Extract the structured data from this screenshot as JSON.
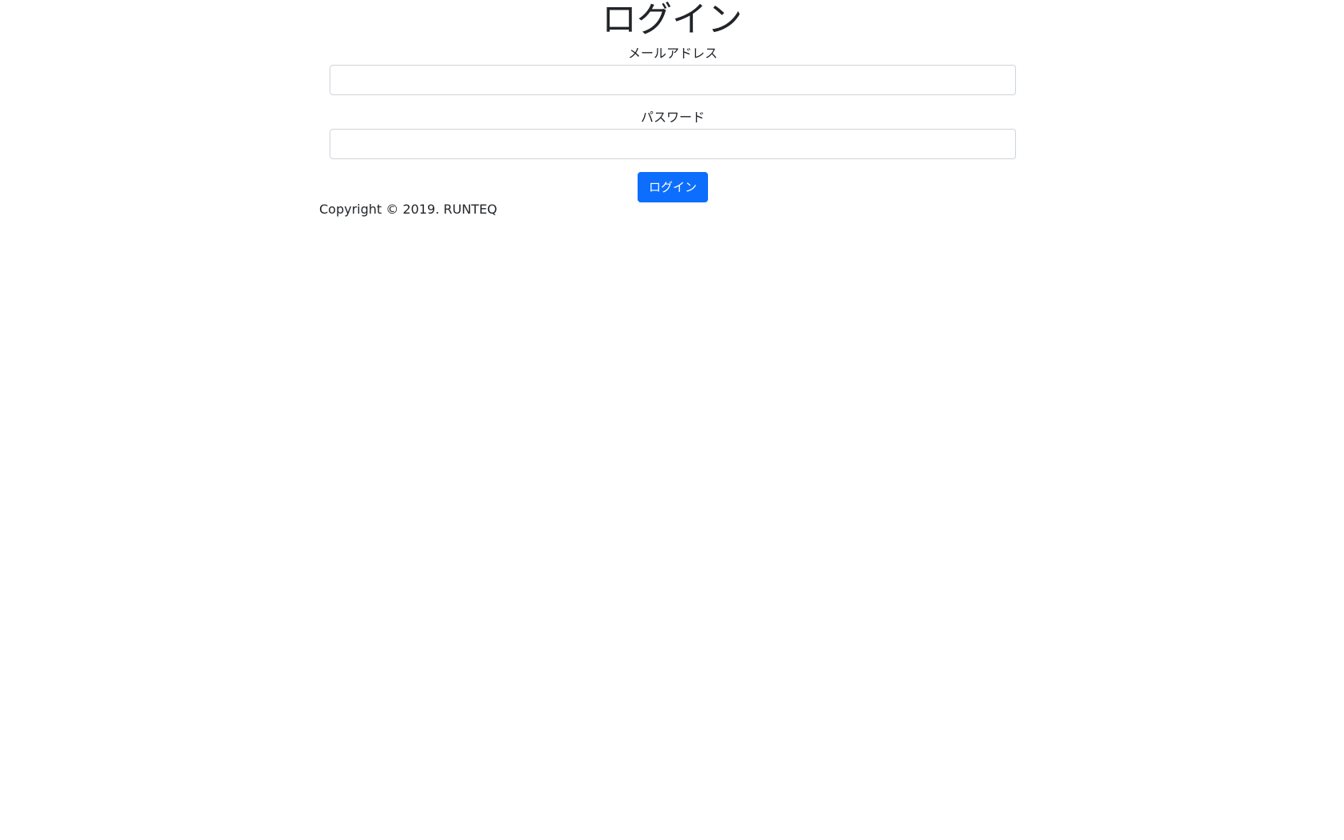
{
  "page": {
    "title": "ログイン"
  },
  "form": {
    "email_label": "メールアドレス",
    "email_value": "",
    "password_label": "パスワード",
    "password_value": "",
    "submit_label": "ログイン"
  },
  "footer": {
    "copyright": "Copyright © 2019. RUNTEQ"
  },
  "colors": {
    "primary": "#0d6efd",
    "text": "#212529",
    "input_border": "#ced4da"
  }
}
